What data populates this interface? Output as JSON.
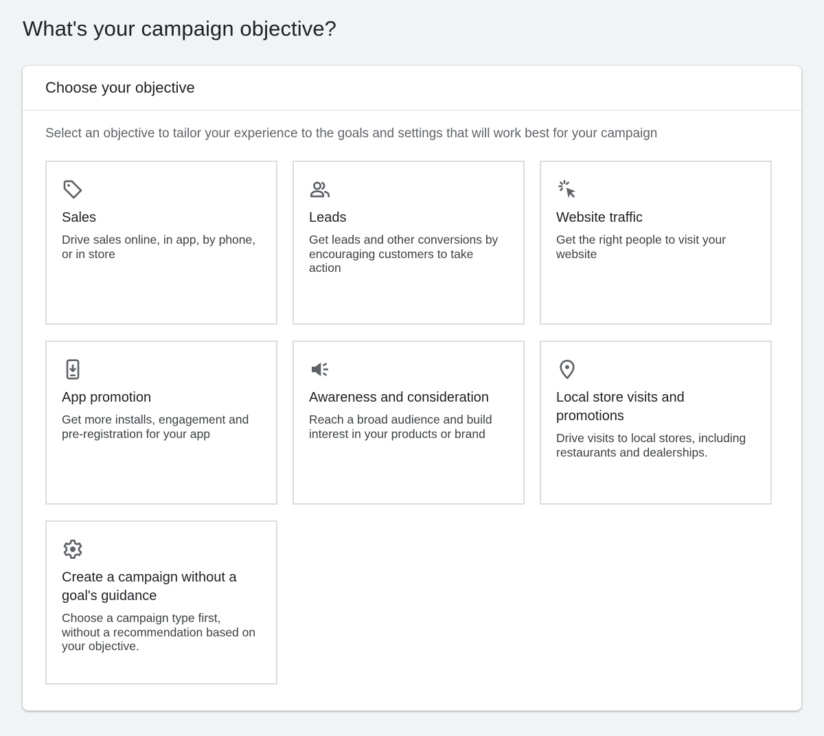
{
  "page": {
    "title": "What's your campaign objective?"
  },
  "card": {
    "title": "Choose your objective",
    "subtitle": "Select an objective to tailor your experience to the goals and settings that will work best for your campaign"
  },
  "objectives": [
    {
      "icon": "tag-icon",
      "title": "Sales",
      "description": "Drive sales online, in app, by phone, or in store"
    },
    {
      "icon": "people-icon",
      "title": "Leads",
      "description": "Get leads and other conversions by encouraging customers to take action"
    },
    {
      "icon": "cursor-click-icon",
      "title": "Website traffic",
      "description": "Get the right people to visit your website"
    },
    {
      "icon": "phone-download-icon",
      "title": "App promotion",
      "description": "Get more installs, engagement and pre-registration for your app"
    },
    {
      "icon": "megaphone-icon",
      "title": "Awareness and consideration",
      "description": "Reach a broad audience and build interest in your products or brand"
    },
    {
      "icon": "location-pin-icon",
      "title": "Local store visits and promotions",
      "description": "Drive visits to local stores, including restaurants and dealerships."
    },
    {
      "icon": "gear-icon",
      "title": "Create a campaign without a goal's guidance",
      "description": "Choose a campaign type first, without a recommendation based on your objective."
    }
  ],
  "colors": {
    "background": "#f1f3f4",
    "card": "#ffffff",
    "border": "#dadce0",
    "icon": "#5f6368",
    "text_primary": "#202124",
    "text_secondary": "#5f6368"
  }
}
